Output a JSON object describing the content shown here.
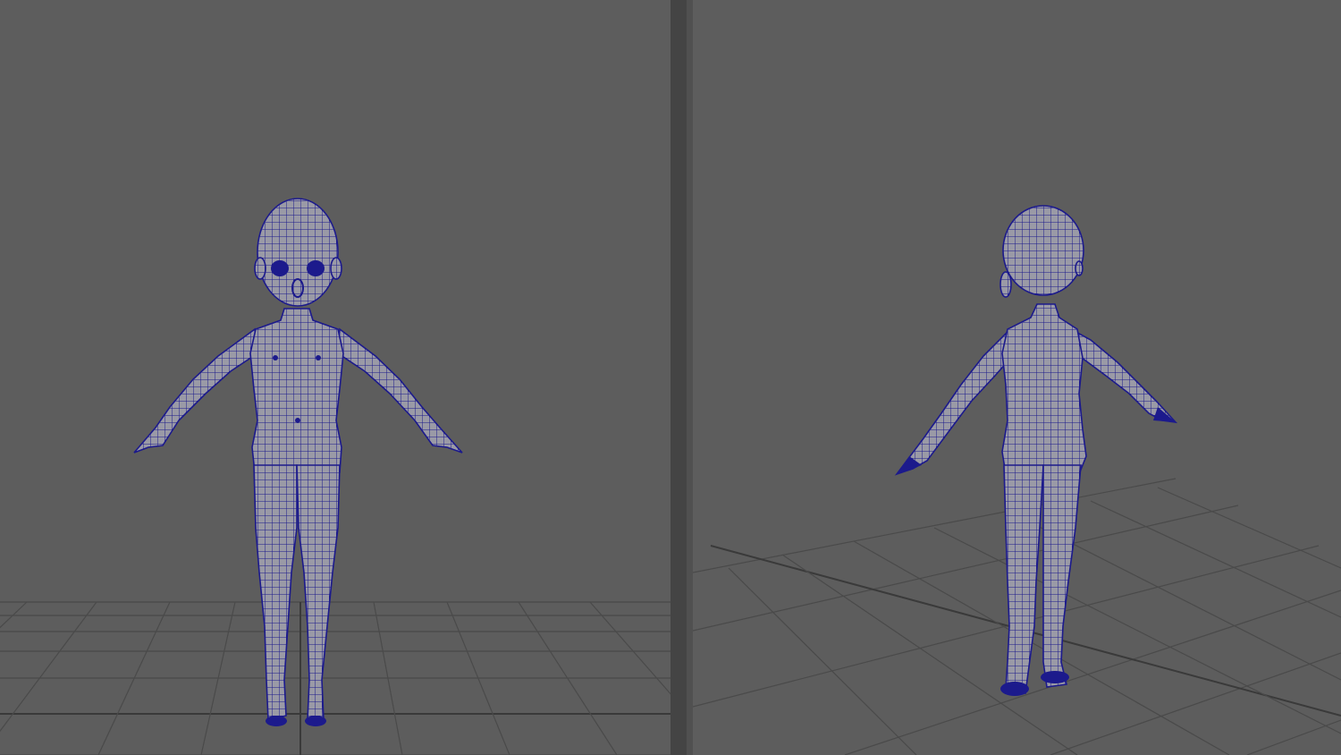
{
  "colors": {
    "viewport_background": "#5d5d5d",
    "splitter": "#444444",
    "grid_line": "#4a4a4a",
    "grid_axis": "#3a3a3a",
    "mesh_fill": "#9a9aa6",
    "mesh_wire": "#1c1a8c"
  },
  "viewports": [
    {
      "id": "front-view",
      "view": "front"
    },
    {
      "id": "perspective-view",
      "view": "back-three-quarter"
    }
  ],
  "model": {
    "type": "polygon-wireframe-character",
    "pose": "A-pose"
  }
}
